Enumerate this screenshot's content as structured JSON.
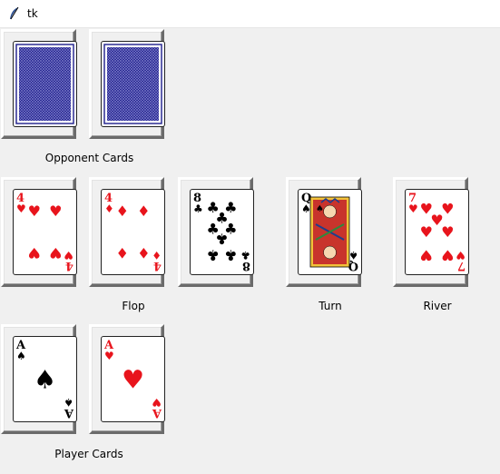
{
  "window": {
    "title": "tk"
  },
  "labels": {
    "opponent": "Opponent Cards",
    "flop": "Flop",
    "turn": "Turn",
    "river": "River",
    "player": "Player Cards"
  },
  "cards": {
    "opponent": [
      {
        "face": "back"
      },
      {
        "face": "back"
      }
    ],
    "flop": [
      {
        "rank": "4",
        "suit": "hearts"
      },
      {
        "rank": "4",
        "suit": "diamonds"
      },
      {
        "rank": "8",
        "suit": "clubs"
      }
    ],
    "turn": [
      {
        "rank": "Q",
        "suit": "spades"
      }
    ],
    "river": [
      {
        "rank": "7",
        "suit": "hearts"
      }
    ],
    "player": [
      {
        "rank": "A",
        "suit": "spades"
      },
      {
        "rank": "A",
        "suit": "hearts"
      }
    ]
  },
  "colors": {
    "red": "#e8141c",
    "black": "#000000",
    "back_blue": "#1c1c8c"
  }
}
